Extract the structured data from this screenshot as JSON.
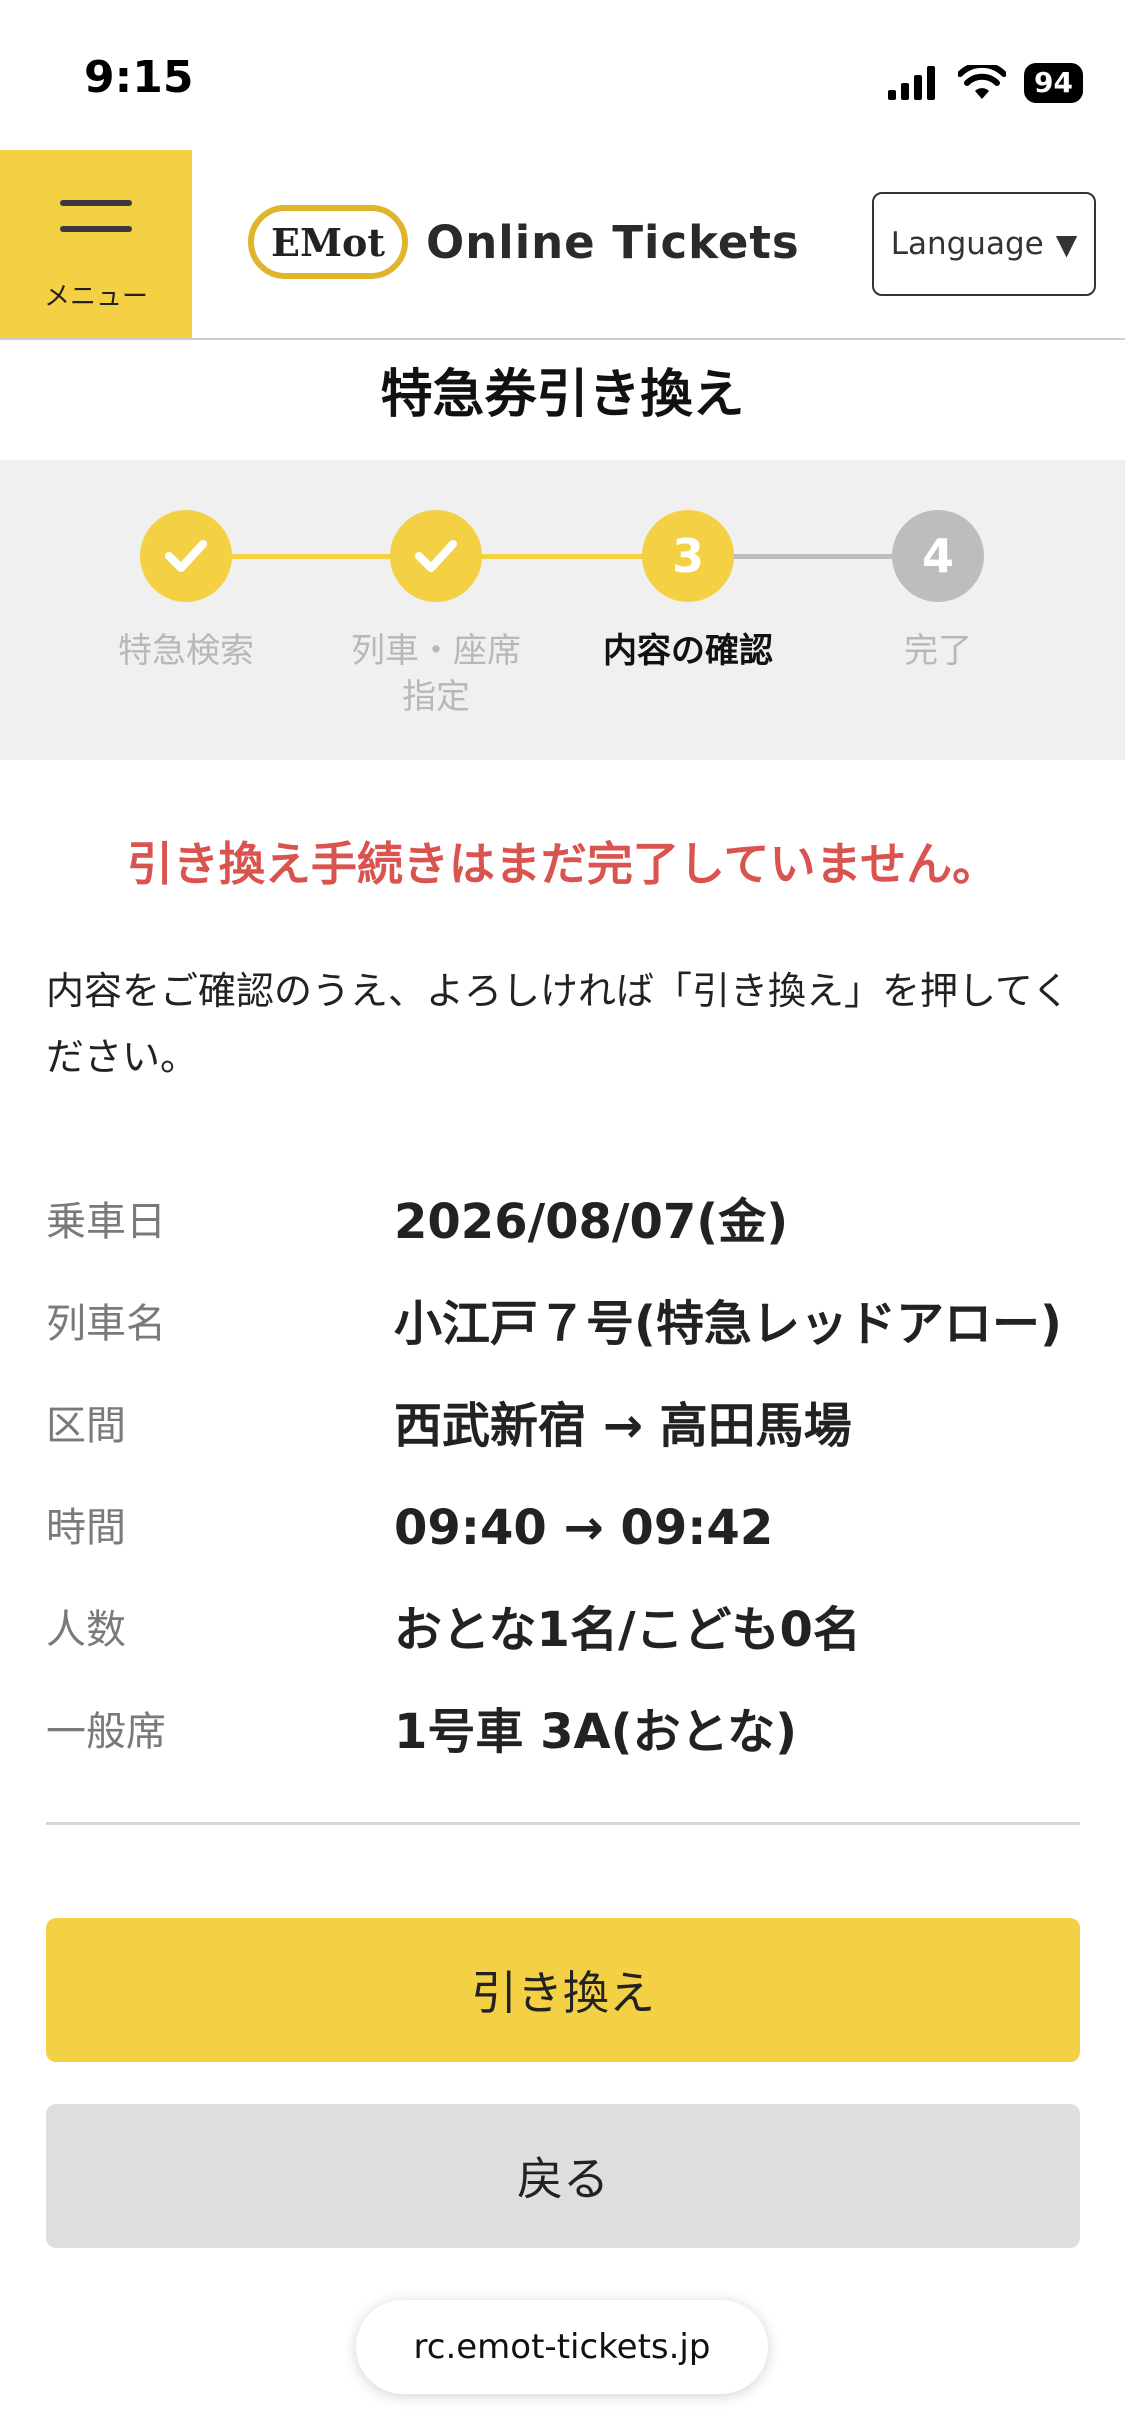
{
  "status_bar": {
    "time": "9:15",
    "battery": "94"
  },
  "header": {
    "menu_label": "メニュー",
    "logo_mark": "EMot",
    "logo_text": "Online Tickets",
    "language_label": "Language",
    "language_arrow": "▼"
  },
  "page_title": "特急券引き換え",
  "steps": [
    {
      "number": "1",
      "label": "特急検索",
      "state": "done"
    },
    {
      "number": "2",
      "label": "列車・座席指定",
      "state": "done"
    },
    {
      "number": "3",
      "label": "内容の確認",
      "state": "current"
    },
    {
      "number": "4",
      "label": "完了",
      "state": "pending"
    }
  ],
  "warning": "引き換え手続きはまだ完了していません。",
  "instruction": "内容をご確認のうえ、よろしければ「引き換え」を押してください。",
  "details": [
    {
      "label": "乗車日",
      "value": "2026/08/07(金)"
    },
    {
      "label": "列車名",
      "value": "小江戸７号(特急レッドアロー)"
    },
    {
      "label": "区間",
      "value": "西武新宿 → 高田馬場"
    },
    {
      "label": "時間",
      "value": "09:40 → 09:42"
    },
    {
      "label": "人数",
      "value": "おとな1名/こども0名"
    },
    {
      "label": "一般席",
      "value": "1号車 3A(おとな)"
    }
  ],
  "buttons": {
    "exchange": "引き換え",
    "back": "戻る"
  },
  "url": "rc.emot-tickets.jp",
  "colors": {
    "accent": "#f4d044",
    "warning": "#d9534f",
    "inactive": "#b8b8b8"
  }
}
